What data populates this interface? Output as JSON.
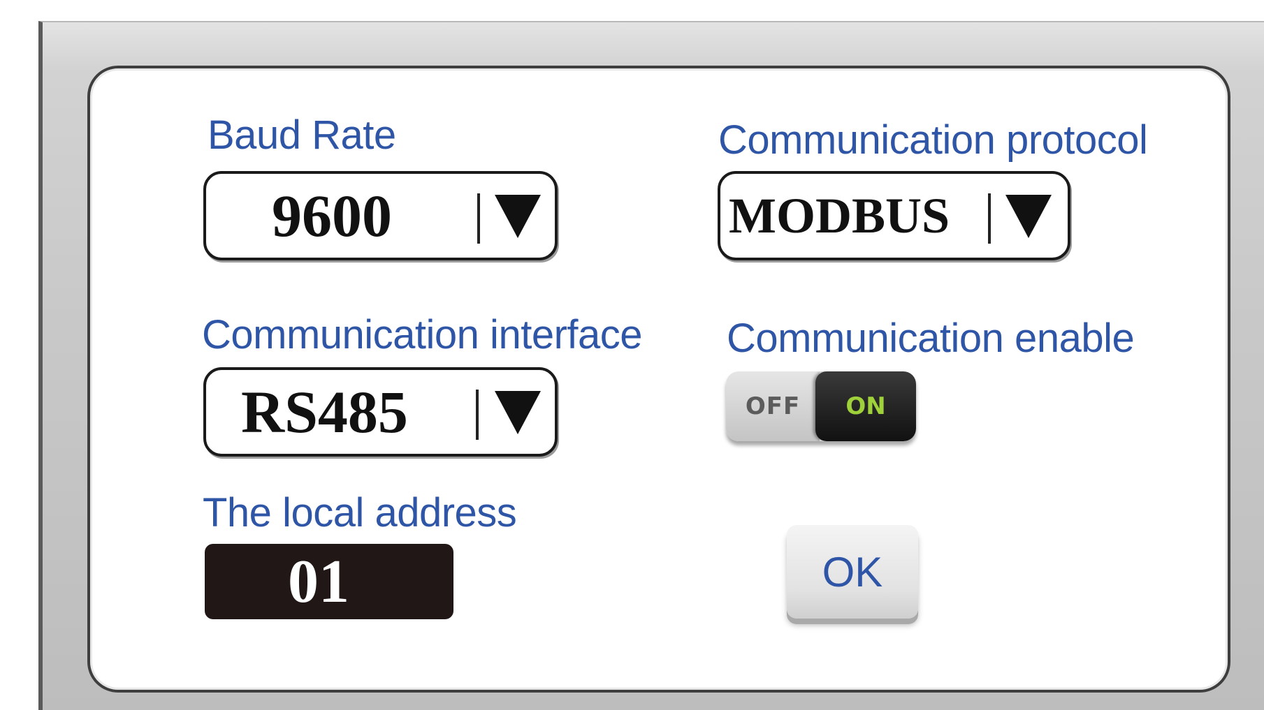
{
  "dialog": {
    "baud_rate": {
      "label": "Baud Rate",
      "value": "9600"
    },
    "communication_protocol": {
      "label": "Communication protocol",
      "value": "MODBUS"
    },
    "communication_interface": {
      "label": "Communication interface",
      "value": "RS485"
    },
    "communication_enable": {
      "label": "Communication enable",
      "off_label": "OFF",
      "on_label": "ON",
      "state": "on"
    },
    "local_address": {
      "label": "The local address",
      "value": "01"
    },
    "ok_button": {
      "label": "OK"
    }
  },
  "icons": {
    "dropdown": "dropdown-arrow-icon"
  },
  "colors": {
    "label_text": "#2f56a6",
    "toggle_on_text": "#9fd13a",
    "address_background": "#201716"
  }
}
